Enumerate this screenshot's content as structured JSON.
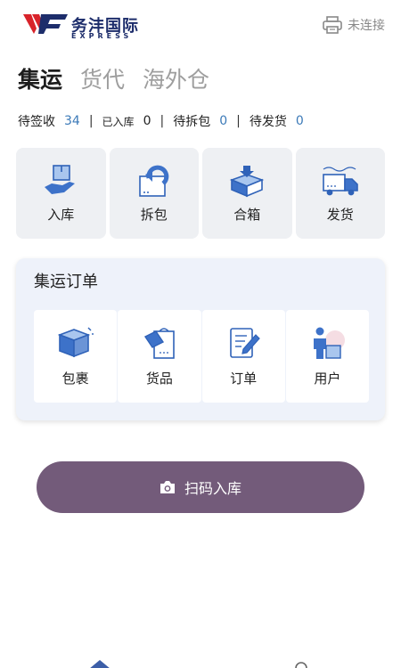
{
  "brand": {
    "name_cn": "务沣国际",
    "name_en": "EXPRESS"
  },
  "printer": {
    "status": "未连接",
    "icon": "printer-icon"
  },
  "tabs": [
    {
      "label": "集运",
      "active": true
    },
    {
      "label": "货代",
      "active": false
    },
    {
      "label": "海外仓",
      "active": false
    }
  ],
  "stats": [
    {
      "label": "待签收",
      "value": "34"
    },
    {
      "label": "已入库",
      "value": "0"
    },
    {
      "label": "待拆包",
      "value": "0"
    },
    {
      "label": "待发货",
      "value": "0"
    }
  ],
  "actions": [
    {
      "label": "入库",
      "icon": "box-hand-icon"
    },
    {
      "label": "拆包",
      "icon": "unpack-icon"
    },
    {
      "label": "合箱",
      "icon": "combine-box-icon"
    },
    {
      "label": "发货",
      "icon": "truck-icon"
    }
  ],
  "orders_card": {
    "title": "集运订单",
    "items": [
      {
        "label": "包裹",
        "icon": "package-icon"
      },
      {
        "label": "货品",
        "icon": "goods-bag-icon"
      },
      {
        "label": "订单",
        "icon": "order-doc-icon"
      },
      {
        "label": "用户",
        "icon": "user-icon"
      }
    ]
  },
  "scan_button": {
    "label": "扫码入库",
    "icon": "camera-icon"
  },
  "colors": {
    "accent": "#3c7ab8",
    "button": "#735b7a",
    "brand_red": "#d8232a",
    "brand_navy": "#1d2d6b"
  }
}
